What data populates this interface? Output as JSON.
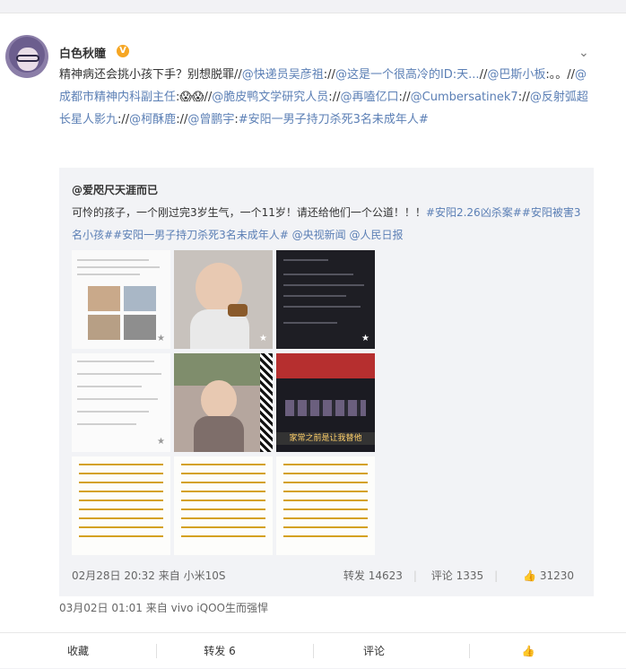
{
  "post": {
    "username": "白色秋瞳",
    "verified_badge": "V",
    "more_icon": "chevron-down-icon",
    "text_segments": [
      {
        "t": "精神病还会挑小孩下手？别想脱罪//",
        "link": false
      },
      {
        "t": "@快递员吴彦祖",
        "link": true
      },
      {
        "t": ":",
        "link": false
      },
      {
        "t": "//",
        "link": false
      },
      {
        "t": "@这是一个很高冷的ID:天...",
        "link": true
      },
      {
        "t": "//",
        "link": false
      },
      {
        "t": "@巴斯小板",
        "link": true
      },
      {
        "t": ":。。//",
        "link": false
      },
      {
        "t": "@成都市精神内科副主任",
        "link": true
      },
      {
        "t": ":",
        "link": false
      },
      {
        "t": "😱😱",
        "link": false
      },
      {
        "t": "//",
        "link": false
      },
      {
        "t": "@脆皮鸭文学研究人员",
        "link": true
      },
      {
        "t": ":",
        "link": false
      },
      {
        "t": "//",
        "link": false
      },
      {
        "t": "@再嗑亿口",
        "link": true
      },
      {
        "t": ":",
        "link": false
      },
      {
        "t": "//",
        "link": false
      },
      {
        "t": "@Cumbersatinek7",
        "link": true
      },
      {
        "t": ":",
        "link": false
      },
      {
        "t": "//",
        "link": false
      },
      {
        "t": "@反射弧超长星人影九",
        "link": true
      },
      {
        "t": ":",
        "link": false
      },
      {
        "t": "//",
        "link": false
      },
      {
        "t": "@柯酥鹿",
        "link": true
      },
      {
        "t": ":",
        "link": false
      },
      {
        "t": "//",
        "link": false
      },
      {
        "t": "@曾鹏宇",
        "link": true
      },
      {
        "t": ":",
        "link": false
      },
      {
        "t": "#安阳一男子持刀杀死3名未成年人#",
        "link": true
      }
    ],
    "time": "03月02日 01:01",
    "source_prefix": "来自",
    "source": "vivo iQOO生而强悍"
  },
  "repost": {
    "username": "@爱咫尺天涯而已",
    "text_segments": [
      {
        "t": "可怜的孩子，一个刚过完3岁生气，一个11岁！请还给他们一个公道！！！",
        "link": false
      },
      {
        "t": "#安阳2.26凶杀案#",
        "link": true
      },
      {
        "t": "#安阳被害3名小孩#",
        "link": true
      },
      {
        "t": "#安阳一男子持刀杀死3名未成年人#",
        "link": true
      },
      {
        "t": " ",
        "link": false
      },
      {
        "t": "@央视新闻",
        "link": true
      },
      {
        "t": " ",
        "link": false
      },
      {
        "t": "@人民日报",
        "link": true
      }
    ],
    "images_banner": "家常之前是让我替他",
    "time": "02月28日 20:32",
    "source_prefix": "来自",
    "source": "小米10S",
    "forward_label": "转发",
    "forward_count": "14623",
    "comment_label": "评论",
    "comment_count": "1335",
    "like_count": "31230"
  },
  "actions": {
    "favorite": "收藏",
    "forward": "转发 6",
    "comment": "评论"
  },
  "colors": {
    "link": "#5b7fb5",
    "badge": "#f6a623"
  }
}
